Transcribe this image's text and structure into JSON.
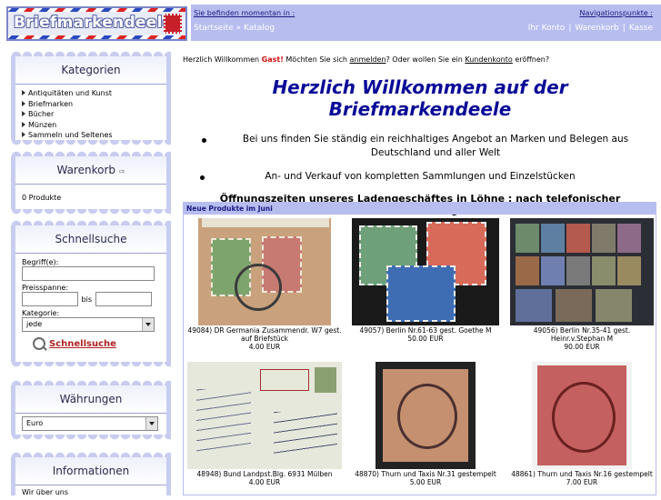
{
  "header": {
    "logo_text": "Briefmarkendeele",
    "location_label": "Sie befinden momentan in :",
    "location_path": "Startseite » Katalog",
    "nav_label": "Navigationspunkte :",
    "nav_links": [
      "Ihr Konto",
      "Warenkorb",
      "Kasse"
    ]
  },
  "sidebar": {
    "kategorien": {
      "title": "Kategorien",
      "items": [
        "Antiquitäten und Kunst",
        "Briefmarken",
        "Bücher",
        "Münzen",
        "Sammeln und Seltenes"
      ]
    },
    "warenkorb": {
      "title": "Warenkorb",
      "content": "0 Produkte"
    },
    "schnellsuche": {
      "title": "Schnellsuche",
      "begriff_label": "Begriff(e):",
      "preis_label": "Preisspanne:",
      "bis_label": "bis",
      "kategorie_label": "Kategorie:",
      "kategorie_value": "jede",
      "button_label": "Schnellsuche"
    },
    "waehrungen": {
      "title": "Währungen",
      "value": "Euro"
    },
    "informationen": {
      "title": "Informationen",
      "first_item": "Wir über uns"
    }
  },
  "main": {
    "welcome_prefix": "Herzlich Willkommen",
    "guest": "Gast!",
    "welcome_mid": "Möchten Sie sich",
    "login_link": "anmelden",
    "welcome_mid2": "? Oder wollen Sie ein",
    "account_link": "Kundenkonto",
    "welcome_suffix": "eröffnen?",
    "title": "Herzlich Willkommen auf der Briefmarkendeele",
    "bullet1": "Bei uns finden Sie ständig ein reichhaltiges Angebot an Marken und Belegen aus Deutschland und aller Welt",
    "bullet2": "An- und Verkauf von kompletten Sammlungen und Einzelstücken",
    "opening": "Öffnungszeiten unseres Ladengeschäftes in Löhne : nach telefonischer Vereinbarung"
  },
  "new_products": {
    "heading": "Neue Produkte im Juni",
    "items": [
      {
        "caption": "49084) DR Germania Zusammendr. W7 gest. auf Briefstück",
        "price": "4.00 EUR"
      },
      {
        "caption": "49057) Berlin Nr.61-63 gest. Goethe M",
        "price": "50.00 EUR"
      },
      {
        "caption": "49056) Berlin Nr.35-41 gest. Heinr.v.Stephan M",
        "price": "90.00 EUR"
      },
      {
        "caption": "48948) Bund Landpst.Blg. 6931 Mülben",
        "price": "4.00 EUR"
      },
      {
        "caption": "48870) Thurn und Taxis Nr.31 gestempelt",
        "price": "5.00 EUR"
      },
      {
        "caption": "48861) Thurn und Taxis Nr.16 gestempelt",
        "price": "7.00 EUR"
      }
    ]
  },
  "colors": {
    "nav_bg": "#b8bdf0",
    "title_blue": "#0a0a98",
    "guest_red": "#d21010",
    "box_border": "#c8ccef"
  }
}
